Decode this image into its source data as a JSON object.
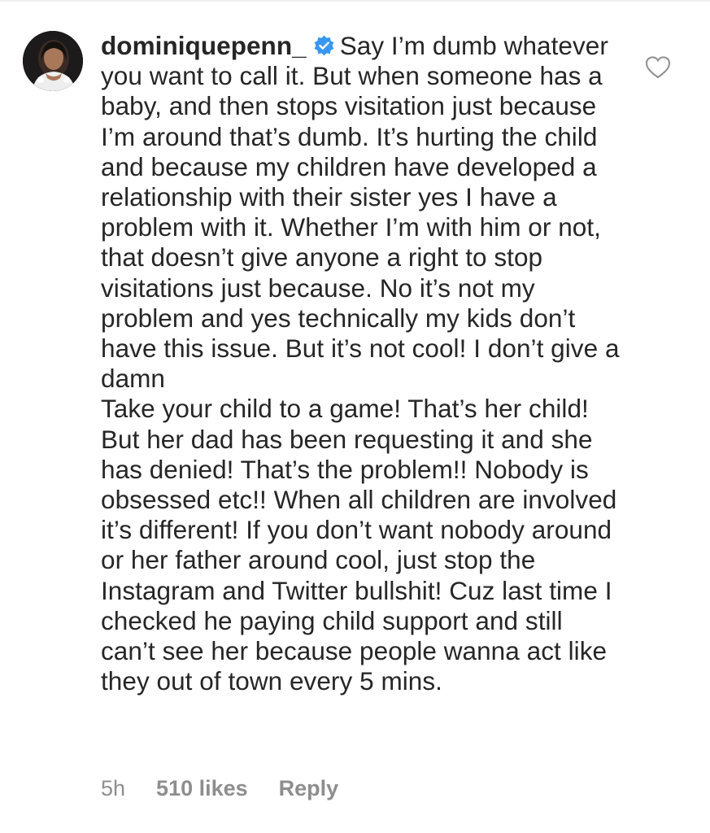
{
  "comment": {
    "username": "dominiquepenn_",
    "verified_icon": "verified-badge-icon",
    "paragraph1": "Say I’m dumb whatever you want to call it. But when someone has a baby, and then stops visitation just because I’m around that’s dumb. It’s hurting the child and because my children have developed a relationship with their sister yes I have a problem with it. Whether I’m with him or not, that doesn’t give anyone a right to stop visitations just because. No it’s not my problem and yes technically my kids don’t have this issue. But it’s not cool! I don’t give a damn",
    "paragraph2": "Take your child to a game! That’s her child! But her dad has been requesting it and she has denied! That’s the problem!! Nobody is obsessed etc!! When all children are involved it’s different! If you don’t want nobody around or her father around cool, just stop the Instagram and Twitter bullshit! Cuz last time I checked he paying child support and still can’t see her because people wanna act like they out of town every 5 mins.",
    "time": "5h",
    "likes": "510 likes",
    "reply_label": "Reply",
    "like_icon": "heart-outline-icon"
  },
  "colors": {
    "text": "#262626",
    "meta": "#8e8e8e",
    "verified": "#3897f0",
    "heart": "#8e8e8e"
  }
}
